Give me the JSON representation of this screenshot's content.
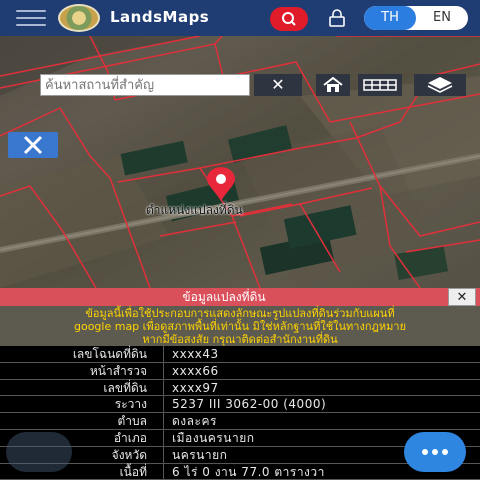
{
  "header": {
    "brand": "LandsMaps",
    "lang_th": "TH",
    "lang_en": "EN",
    "active_lang": "TH"
  },
  "map": {
    "search_placeholder": "ค้นหาสถานที่สำคัญ",
    "clear_label": "✕",
    "parcel_label": "ตำแหน่งแปลงที่ดิน"
  },
  "info": {
    "title": "ข้อมูลแปลงที่ดิน",
    "close_label": "✕",
    "notice_line1": "ข้อมูลนี้เพื่อใช้ประกอบการแสดงลักษณะรูปแปลงที่ดินร่วมกับแผนที่",
    "notice_line2": "google map เพื่อดูสภาพพื้นที่เท่านั้น มิใช่หลักฐานที่ใช้ในทางกฎหมาย",
    "notice_line3": "หากมีข้อสงสัย กรุณาติดต่อสำนักงานที่ดิน",
    "rows": [
      {
        "label": "เลขโฉนดที่ดิน",
        "value": "xxxx43"
      },
      {
        "label": "หน้าสำรวจ",
        "value": "xxxx66"
      },
      {
        "label": "เลขที่ดิน",
        "value": "xxxx97"
      },
      {
        "label": "ระวาง",
        "value": "5237 III 3062-00 (4000)"
      },
      {
        "label": "ตำบล",
        "value": "ดงละคร"
      },
      {
        "label": "อำเภอ",
        "value": "เมืองนครนายก"
      },
      {
        "label": "จังหวัด",
        "value": "นครนายก"
      },
      {
        "label": "เนื้อที่",
        "value": "6 ไร่ 0 งาน 77.0 ตารางวา"
      }
    ]
  },
  "colors": {
    "topbar": "#1f3c73",
    "accent_red": "#e11c2a",
    "accent_blue": "#2e86e0",
    "parcel_line": "#e0303a",
    "notice_text": "#ffd400"
  },
  "icons": [
    "menu-icon",
    "search-icon",
    "lock-icon",
    "home-icon",
    "grid-icon",
    "layers-icon",
    "ruler-icon",
    "location-pin-icon",
    "more-icon"
  ]
}
